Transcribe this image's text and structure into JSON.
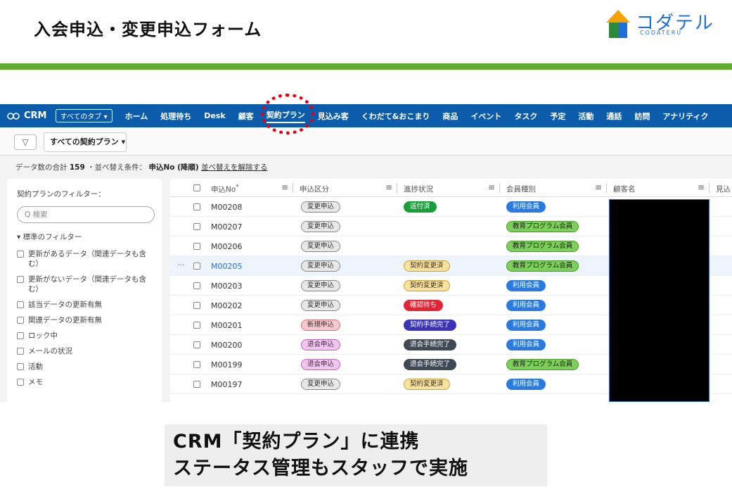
{
  "slide": {
    "title": "入会申込・変更申込フォーム",
    "logo_text": "コダテル",
    "logo_sub": "CODATERU",
    "caption_line1": "CRM「契約プラン」に連携",
    "caption_line2": "ステータス管理もスタッフで実施"
  },
  "nav": {
    "app": "CRM",
    "tab_select": "すべてのタブ ▾",
    "items": [
      "ホーム",
      "処理待ち",
      "Desk",
      "顧客",
      "契約プラン",
      "見込み客",
      "くわだて&おこまり",
      "商品",
      "イベント",
      "タスク",
      "予定",
      "活動",
      "通話",
      "訪問",
      "アナリティク"
    ],
    "active": "契約プラン"
  },
  "filterbar": {
    "filter_icon": "funnel-icon",
    "view": "すべての契約プラン ▾"
  },
  "summary": {
    "prefix": "データ数の合計",
    "count": "159",
    "sort_text": "・並べ替え条件：",
    "sort_field": "申込No (降順)",
    "unsort_link": "並べ替えを解除する"
  },
  "sidebar": {
    "title": "契約プランのフィルター：",
    "search_placeholder": "Q 検索",
    "group": "▾ 標準のフィルター",
    "items": [
      "更新があるデータ（関連データも含む）",
      "更新がないデータ（関連データも含む）",
      "該当データの更新有無",
      "関連データの更新有無",
      "ロック中",
      "メールの状況",
      "活動",
      "メモ"
    ]
  },
  "table": {
    "headers": [
      "申込No",
      "申込区分",
      "進捗状況",
      "会員種別",
      "顧客名",
      "見込"
    ],
    "required_mark": "*",
    "rows": [
      {
        "no": "M00208",
        "kubun": "変更申込",
        "status": "送付済",
        "member": "利用会員"
      },
      {
        "no": "M00207",
        "kubun": "変更申込",
        "status": "",
        "member": "教育プログラム会員"
      },
      {
        "no": "M00206",
        "kubun": "変更申込",
        "status": "",
        "member": "教育プログラム会員"
      },
      {
        "no": "M00205",
        "kubun": "変更申込",
        "status": "契約変更済",
        "member": "教育プログラム会員"
      },
      {
        "no": "M00203",
        "kubun": "変更申込",
        "status": "契約変更済",
        "member": "利用会員"
      },
      {
        "no": "M00202",
        "kubun": "変更申込",
        "status": "確認待ち",
        "member": "利用会員"
      },
      {
        "no": "M00201",
        "kubun": "新規申込",
        "status": "契約手続完了",
        "member": "利用会員"
      },
      {
        "no": "M00200",
        "kubun": "退会申込",
        "status": "退会手続完了",
        "member": "利用会員"
      },
      {
        "no": "M00199",
        "kubun": "退会申込",
        "status": "退会手続完了",
        "member": "教育プログラム会員"
      },
      {
        "no": "M00197",
        "kubun": "変更申込",
        "status": "契約変更済",
        "member": "利用会員"
      }
    ],
    "row_more": "···"
  },
  "colors": {
    "nav_bg": "#0b5cab",
    "green_bar": "#5fae32",
    "highlight_circle": "#e60012",
    "pill_change": "#e8e8e8",
    "pill_new": "#f8c8cf",
    "pill_withdraw": "#f3c4f0",
    "pill_sent": "#1a9e3a",
    "pill_changed": "#fbe29a",
    "pill_confirm": "#e32636",
    "pill_contract_done": "#3a33b8",
    "pill_withdraw_done": "#3f4955",
    "pill_member": "#2a7be0",
    "pill_edu": "#7ccf58"
  }
}
